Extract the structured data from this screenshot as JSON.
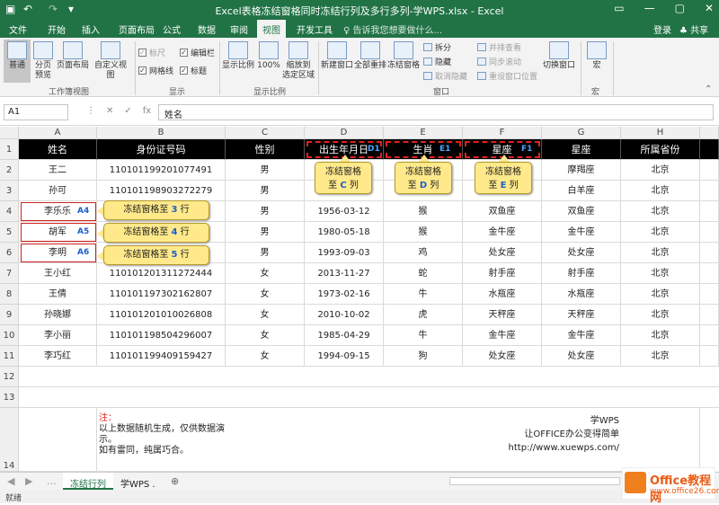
{
  "app": {
    "title": "Excel表格冻结窗格同时冻结行列及多行多列-学WPS.xlsx - Excel",
    "undo_icon": "undo-icon",
    "redo_icon": "redo-icon",
    "save_icon": "save-icon"
  },
  "tabs": [
    "文件",
    "开始",
    "插入",
    "页面布局",
    "公式",
    "数据",
    "审阅",
    "视图",
    "开发工具"
  ],
  "tell_me": "♀ 告诉我您想要做什么...",
  "login": "登录",
  "share": "♣ 共享",
  "ribbon": {
    "groups": [
      "工作簿视图",
      "显示",
      "显示比例",
      "窗口",
      "宏"
    ],
    "view_buttons": [
      "普通",
      "分页\n预览",
      "页面布局",
      "自定义视图"
    ],
    "show_checks": [
      {
        "label": "标尺",
        "checked": true,
        "disabled": true
      },
      {
        "label": "编辑栏",
        "checked": true
      },
      {
        "label": "网格线",
        "checked": true
      },
      {
        "label": "标题",
        "checked": true
      }
    ],
    "zoom_buttons": [
      "显示比例",
      "100%",
      "缩放到\n选定区域"
    ],
    "window_buttons": [
      "新建窗口",
      "全部重排",
      "冻结窗格"
    ],
    "window_small": [
      "拆分",
      "隐藏",
      "取消隐藏"
    ],
    "window_small2": [
      "并排查看",
      "同步滚动",
      "重设窗口位置"
    ],
    "switch_window": "切换窗口",
    "macro": "宏"
  },
  "name_box": "A1",
  "formula": "姓名",
  "columns": [
    "A",
    "B",
    "C",
    "D",
    "E",
    "F",
    "G",
    "H"
  ],
  "rows": [
    "1",
    "2",
    "3",
    "4",
    "5",
    "6",
    "7",
    "8",
    "9",
    "10",
    "11",
    "12",
    "13",
    "14"
  ],
  "header_row": [
    "姓名",
    "身份证号码",
    "性别",
    "出生年月日",
    "生肖",
    "星座",
    "星座",
    "所属省份"
  ],
  "data": [
    [
      "王二",
      "110101199201077491",
      "男",
      "",
      "",
      "",
      "摩羯座",
      "北京"
    ],
    [
      "孙可",
      "110101198903272279",
      "男",
      "",
      "",
      "",
      "白羊座",
      "北京"
    ],
    [
      "李乐乐",
      "",
      "男",
      "1956-03-12",
      "猴",
      "双鱼座",
      "双鱼座",
      "北京"
    ],
    [
      "胡军",
      "",
      "男",
      "1980-05-18",
      "猴",
      "金牛座",
      "金牛座",
      "北京"
    ],
    [
      "李明",
      "",
      "男",
      "1993-09-03",
      "鸡",
      "处女座",
      "处女座",
      "北京"
    ],
    [
      "王小红",
      "110101201311272444",
      "女",
      "2013-11-27",
      "蛇",
      "射手座",
      "射手座",
      "北京"
    ],
    [
      "王倩",
      "110101197302162807",
      "女",
      "1973-02-16",
      "牛",
      "水瓶座",
      "水瓶座",
      "北京"
    ],
    [
      "孙晓娜",
      "110101201010026808",
      "女",
      "2010-10-02",
      "虎",
      "天秤座",
      "天秤座",
      "北京"
    ],
    [
      "李小丽",
      "110101198504296007",
      "女",
      "1985-04-29",
      "牛",
      "金牛座",
      "金牛座",
      "北京"
    ],
    [
      "李巧红",
      "110101199409159427",
      "女",
      "1994-09-15",
      "狗",
      "处女座",
      "处女座",
      "北京"
    ]
  ],
  "refs": {
    "D1": "D1",
    "E1": "E1",
    "F1": "F1",
    "A4": "A4",
    "A5": "A5",
    "A6": "A6"
  },
  "callouts_col": [
    {
      "line1": "冻结窗格",
      "pre": "至 ",
      "col": "C",
      "post": " 列"
    },
    {
      "line1": "冻结窗格",
      "pre": "至 ",
      "col": "D",
      "post": " 列"
    },
    {
      "line1": "冻结窗格",
      "pre": "至 ",
      "col": "E",
      "post": " 列"
    }
  ],
  "callouts_row": [
    {
      "pre": "冻结窗格至 ",
      "num": "3",
      "post": " 行"
    },
    {
      "pre": "冻结窗格至 ",
      "num": "4",
      "post": " 行"
    },
    {
      "pre": "冻结窗格至 ",
      "num": "5",
      "post": " 行"
    }
  ],
  "note_left": {
    "title": "注：",
    "line1": "以上数据随机生成，仅供数据演示。",
    "line2": "如有雷同，纯属巧合。"
  },
  "note_right": [
    "学WPS",
    "让OFFICE办公变得简单",
    "http://www.xuewps.com/"
  ],
  "sheet_tabs": [
    "冻结行列",
    "学WPS ."
  ],
  "status": "就绪",
  "watermark": {
    "brand": "Office教程网",
    "url": "www.office26.com"
  },
  "colors": {
    "excel_green": "#217346",
    "callout": "#ffe98a",
    "ref_blue": "#1a5fd0",
    "dash_red": "#e02020"
  }
}
